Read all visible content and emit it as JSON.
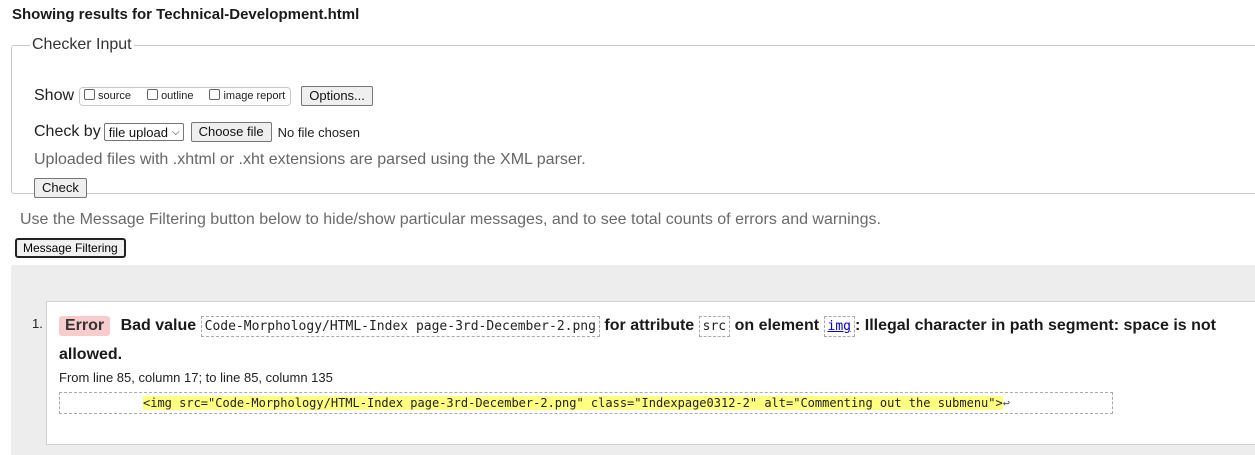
{
  "page": {
    "title": "Showing results for Technical-Development.html"
  },
  "checker": {
    "legend": "Checker Input",
    "show_label": "Show",
    "show_options": [
      {
        "label": "source",
        "checked": false
      },
      {
        "label": "outline",
        "checked": false
      },
      {
        "label": "image report",
        "checked": false
      }
    ],
    "options_button": "Options...",
    "checkby_label": "Check by",
    "checkby_value": "file upload",
    "choose_file_button": "Choose file",
    "no_file_text": "No file chosen",
    "hint": "Uploaded files with .xhtml or .xht extensions are parsed using the XML parser.",
    "check_button": "Check"
  },
  "filter": {
    "hint": "Use the Message Filtering button below to hide/show particular messages, and to see total counts of errors and warnings.",
    "button": "Message Filtering"
  },
  "messages": [
    {
      "number": "1.",
      "type": "Error",
      "text_before": "Bad value",
      "value": "Code-Morphology/HTML-Index page-3rd-December-2.png",
      "text_attr": "for attribute",
      "attribute": "src",
      "text_element": "on element",
      "element": "img",
      "text_after": ": Illegal character in path segment: space is not allowed.",
      "location": "From line 85, column 17; to line 85, column 135",
      "extract": "<img src=\"Code-Morphology/HTML-Index page-3rd-December-2.png\" class=\"Indexpage0312-2\" alt=\"Commenting out the submenu\">",
      "extract_return": "↩"
    }
  ],
  "colors": {
    "error_badge": "#f8cccc",
    "highlight": "#ffff80",
    "results_bg": "#ededed",
    "link": "#0000cc"
  }
}
